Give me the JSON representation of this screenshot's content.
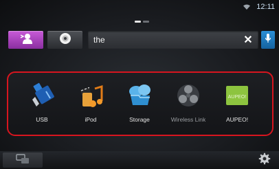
{
  "status": {
    "clock": "12:11",
    "wifi_icon": "wifi-icon"
  },
  "pager": {
    "pages": 2,
    "active": 1
  },
  "toolbar": {
    "speak_icon": "voice-speak-icon",
    "disc_icon": "disc-icon",
    "search": {
      "value": "the"
    },
    "clear_icon": "close-icon",
    "clear_glyph": "✕",
    "mic_icon": "microphone-icon"
  },
  "sources": [
    {
      "label": "USB",
      "icon": "usb-icon",
      "dim": false
    },
    {
      "label": "iPod",
      "icon": "ipod-icon",
      "dim": false
    },
    {
      "label": "Storage",
      "icon": "storage-icon",
      "dim": false
    },
    {
      "label": "Wireless Link",
      "icon": "wireless-link-icon",
      "dim": true
    },
    {
      "label": "AUPEO!",
      "icon": "aupeo-icon",
      "dim": false
    }
  ],
  "colors": {
    "highlight_border": "#d8151f",
    "accent_purple": "#9c3bb5",
    "accent_blue": "#1c78c2"
  },
  "bottom": {
    "left_icon": "screen-mirror-icon",
    "right_icon": "gear-icon"
  }
}
